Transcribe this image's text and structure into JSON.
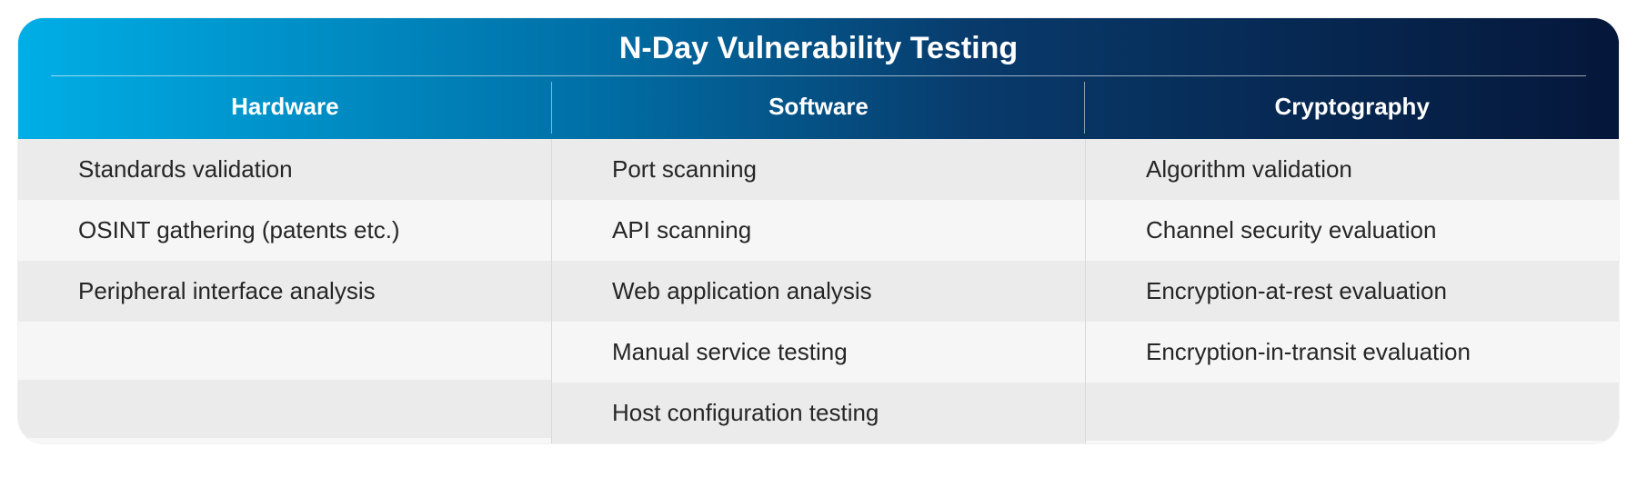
{
  "title": "N-Day Vulnerability Testing",
  "columns": [
    {
      "header": "Hardware",
      "items": [
        "Standards validation",
        "OSINT gathering (patents etc.)",
        "Peripheral interface analysis",
        "",
        ""
      ]
    },
    {
      "header": "Software",
      "items": [
        "Port scanning",
        "API scanning",
        "Web application analysis",
        "Manual service testing",
        "Host configuration testing"
      ]
    },
    {
      "header": "Cryptography",
      "items": [
        "Algorithm validation",
        "Channel security evaluation",
        "Encryption-at-rest evaluation",
        "Encryption-in-transit evaluation",
        ""
      ]
    }
  ]
}
